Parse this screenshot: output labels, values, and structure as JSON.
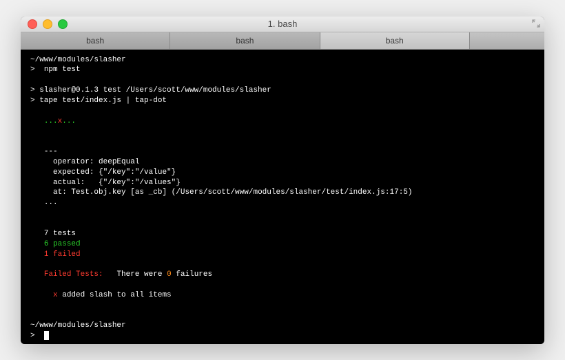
{
  "window": {
    "title": "1. bash"
  },
  "tabs": [
    {
      "label": "bash"
    },
    {
      "label": "bash"
    },
    {
      "label": "bash"
    },
    {
      "label": ""
    }
  ],
  "active_tab_index": 2,
  "terminal": {
    "cwd": "~/www/modules/slasher",
    "prompt_char": ">",
    "command": "npm test",
    "runner_line1": "> slasher@0.1.3 test /Users/scott/www/modules/slasher",
    "runner_line2": "> tape test/index.js | tap-dot",
    "dots_pass": "...",
    "dots_fail": "x",
    "dots_pass2": "...",
    "divider": "---",
    "operator_line": "operator: deepEqual",
    "expected_line": "expected: {\"/key\":\"/value\"}",
    "actual_line": "actual:   {\"/key\":\"/values\"}",
    "at_line": "at: Test.obj.key [as _cb] (/Users/scott/www/modules/slasher/test/index.js:17:5)",
    "trailing_dots": "...",
    "tests_count": "7 tests",
    "passed_count": "6 passed",
    "failed_count": "1 failed",
    "failed_tests_label": "Failed Tests:",
    "failed_summary_prefix": "There were ",
    "failed_summary_number": "0",
    "failed_summary_suffix": " failures",
    "failed_item_marker": "x",
    "failed_item": " added slash to all items",
    "cwd2": "~/www/modules/slasher",
    "prompt_char2": ">"
  }
}
